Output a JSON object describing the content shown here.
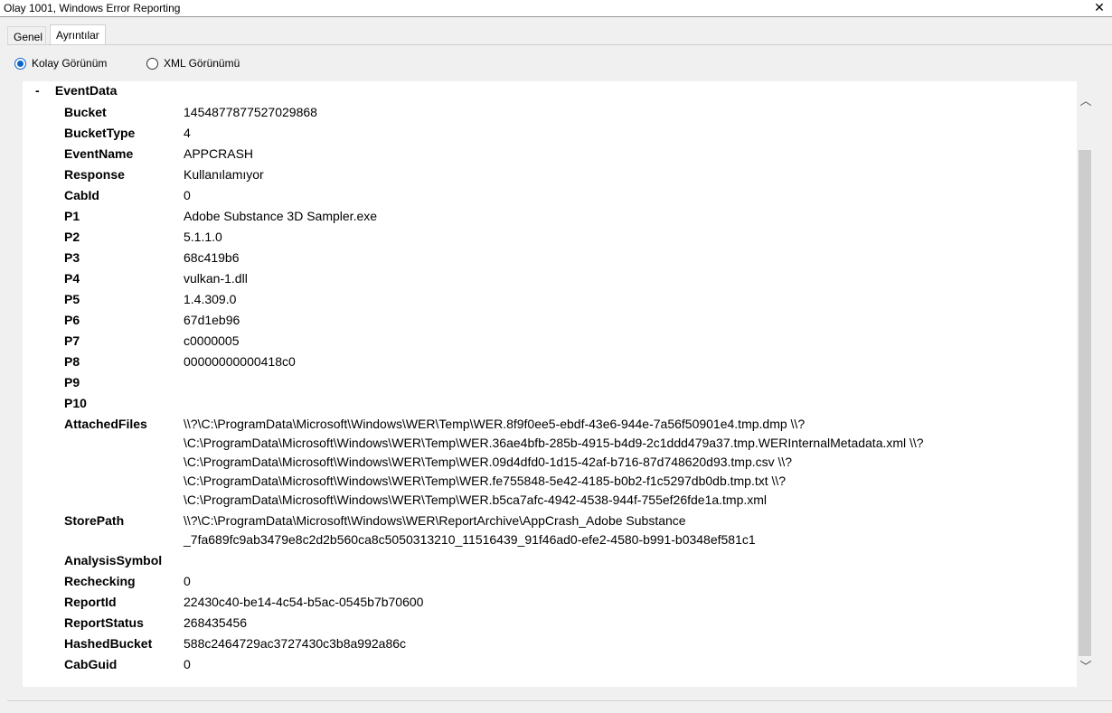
{
  "window": {
    "title": "Olay 1001, Windows Error Reporting",
    "close": "✕"
  },
  "tabs": [
    {
      "label": "Genel"
    },
    {
      "label": "Ayrıntılar"
    }
  ],
  "view": {
    "options": [
      {
        "label": "Kolay Görünüm",
        "selected": true
      },
      {
        "label": "XML Görünümü",
        "selected": false
      }
    ]
  },
  "eventdata": {
    "toggle": "-",
    "title": "EventData",
    "rows": [
      {
        "key": "Bucket",
        "value": "1454877877527029868"
      },
      {
        "key": "BucketType",
        "value": "4"
      },
      {
        "key": "EventName",
        "value": "APPCRASH"
      },
      {
        "key": "Response",
        "value": "Kullanılamıyor"
      },
      {
        "key": "CabId",
        "value": "0"
      },
      {
        "key": "P1",
        "value": "Adobe Substance 3D Sampler.exe"
      },
      {
        "key": "P2",
        "value": "5.1.1.0"
      },
      {
        "key": "P3",
        "value": "68c419b6"
      },
      {
        "key": "P4",
        "value": "vulkan-1.dll"
      },
      {
        "key": "P5",
        "value": "1.4.309.0"
      },
      {
        "key": "P6",
        "value": "67d1eb96"
      },
      {
        "key": "P7",
        "value": "c0000005"
      },
      {
        "key": "P8",
        "value": "00000000000418c0"
      },
      {
        "key": "P9",
        "value": ""
      },
      {
        "key": "P10",
        "value": ""
      },
      {
        "key": "AttachedFiles",
        "value": "\\\\?\\C:\\ProgramData\\Microsoft\\Windows\\WER\\Temp\\WER.8f9f0ee5-ebdf-43e6-944e-7a56f50901e4.tmp.dmp \\\\?\n\\C:\\ProgramData\\Microsoft\\Windows\\WER\\Temp\\WER.36ae4bfb-285b-4915-b4d9-2c1ddd479a37.tmp.WERInternalMetadata.xml \\\\?\n\\C:\\ProgramData\\Microsoft\\Windows\\WER\\Temp\\WER.09d4dfd0-1d15-42af-b716-87d748620d93.tmp.csv \\\\?\n\\C:\\ProgramData\\Microsoft\\Windows\\WER\\Temp\\WER.fe755848-5e42-4185-b0b2-f1c5297db0db.tmp.txt \\\\?\n\\C:\\ProgramData\\Microsoft\\Windows\\WER\\Temp\\WER.b5ca7afc-4942-4538-944f-755ef26fde1a.tmp.xml"
      },
      {
        "key": "StorePath",
        "value": "\\\\?\\C:\\ProgramData\\Microsoft\\Windows\\WER\\ReportArchive\\AppCrash_Adobe Substance\n_7fa689fc9ab3479e8c2d2b560ca8c5050313210_11516439_91f46ad0-efe2-4580-b991-b0348ef581c1"
      },
      {
        "key": "AnalysisSymbol",
        "value": ""
      },
      {
        "key": "Rechecking",
        "value": "0"
      },
      {
        "key": "ReportId",
        "value": "22430c40-be14-4c54-b5ac-0545b7b70600"
      },
      {
        "key": "ReportStatus",
        "value": "268435456"
      },
      {
        "key": "HashedBucket",
        "value": "588c2464729ac3727430c3b8a992a86c"
      },
      {
        "key": "CabGuid",
        "value": "0"
      }
    ]
  },
  "scrollbar": {
    "up": "︿",
    "down": "﹀"
  }
}
